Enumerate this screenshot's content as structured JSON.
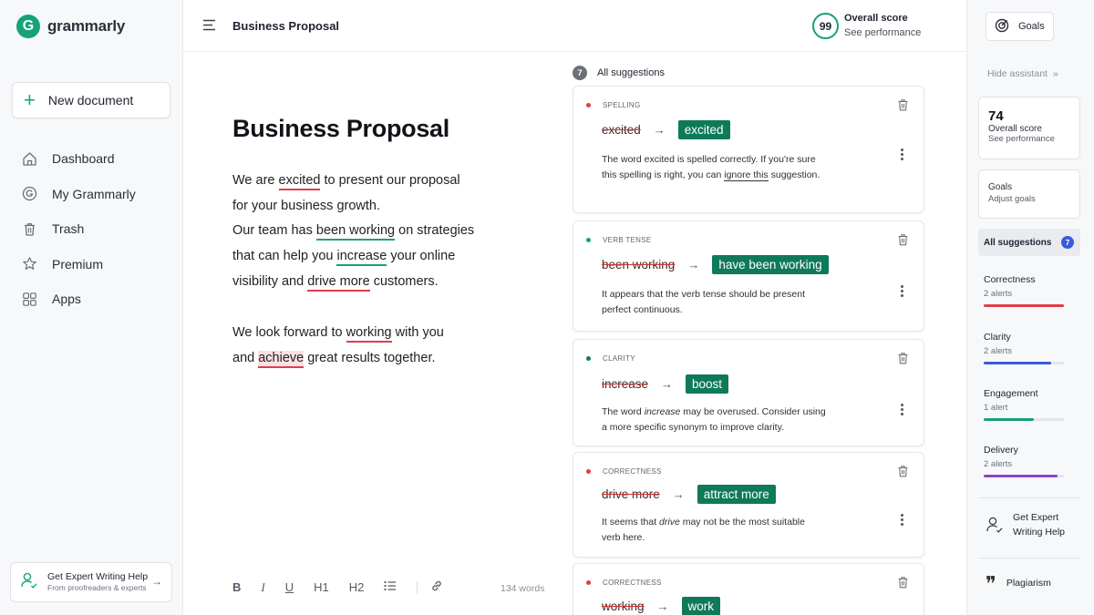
{
  "app": {
    "name": "grammarly",
    "logo_letter": "G",
    "brand_color": "#15a276"
  },
  "sidebar": {
    "new_document": "New document",
    "nav": [
      {
        "label": "Dashboard",
        "icon": "home-icon"
      },
      {
        "label": "My Grammarly",
        "icon": "grammarly-g-icon"
      },
      {
        "label": "Trash",
        "icon": "trash-icon"
      },
      {
        "label": "Premium",
        "icon": "star-icon"
      },
      {
        "label": "Apps",
        "icon": "apps-grid-icon"
      }
    ],
    "expert": {
      "title": "Get Expert Writing Help",
      "subtitle": "From proofreaders & experts"
    }
  },
  "header": {
    "doc_title": "Business Proposal",
    "score": "99",
    "score_label": "Overall score",
    "score_link": "See performance"
  },
  "document": {
    "heading": "Business Proposal",
    "lines": [
      [
        "We are ",
        "excited",
        " to present our proposal"
      ],
      [
        "for your business growth."
      ],
      [
        "Our team has ",
        "been working",
        " on strategies"
      ],
      [
        "that can help you ",
        "increase",
        " your online"
      ],
      [
        "visibility and ",
        "drive more",
        " customers."
      ],
      [
        "We look forward to ",
        "working",
        " with you"
      ],
      [
        "and ",
        "achieve",
        " great results together."
      ]
    ],
    "word_count": "134 words",
    "toolbar": {
      "bold": "B",
      "italic": "I",
      "underline": "U",
      "h1": "H1",
      "h2": "H2"
    }
  },
  "suggestions": {
    "count": "7",
    "header": "All suggestions",
    "cards": [
      {
        "category": "SPELLING",
        "dot_color": "#e23c4b",
        "old": "excited",
        "new": "excited",
        "desc_parts": [
          "The word excited is spelled correctly. If you're sure this spelling is right, you can ",
          "ignore this",
          " suggestion."
        ]
      },
      {
        "category": "VERB TENSE",
        "dot_color": "#15a276",
        "old": "been working",
        "new": "have been working",
        "desc_parts": [
          "It appears that the verb tense should be present perfect continuous."
        ]
      },
      {
        "category": "CLARITY",
        "dot_color": "#0f7a5a",
        "old": "increase",
        "new": "boost",
        "desc_parts": [
          "The word ",
          "increase",
          " may be overused. Consider using a more specific synonym to improve clarity."
        ]
      },
      {
        "category": "CORRECTNESS",
        "dot_color": "#e23c4b",
        "old": "drive more",
        "new": "attract more",
        "desc_parts": [
          "It seems that ",
          "drive",
          " may not be the most suitable verb here."
        ]
      },
      {
        "category": "CORRECTNESS",
        "dot_color": "#e23c4b",
        "old": "working",
        "new": "work"
      }
    ]
  },
  "assistant": {
    "goals_button": "Goals",
    "hide": "Hide assistant",
    "score": {
      "value": "74",
      "label": "Overall score",
      "link": "See performance"
    },
    "goals": {
      "label": "Goals",
      "link": "Adjust goals"
    },
    "all_suggestions": {
      "label": "All suggestions",
      "count": "7"
    },
    "metrics": [
      {
        "name": "Correctness",
        "alerts": "2 alerts",
        "color": "#e23c4b",
        "level": 1.0
      },
      {
        "name": "Clarity",
        "alerts": "2 alerts",
        "color": "#3b5bdb",
        "level": 0.84
      },
      {
        "name": "Engagement",
        "alerts": "1 alert",
        "color": "#15a276",
        "level": 0.63
      },
      {
        "name": "Delivery",
        "alerts": "2 alerts",
        "color": "#8e44c9",
        "level": 0.92
      }
    ],
    "expert": "Get Expert Writing Help",
    "plagiarism": "Plagiarism"
  }
}
